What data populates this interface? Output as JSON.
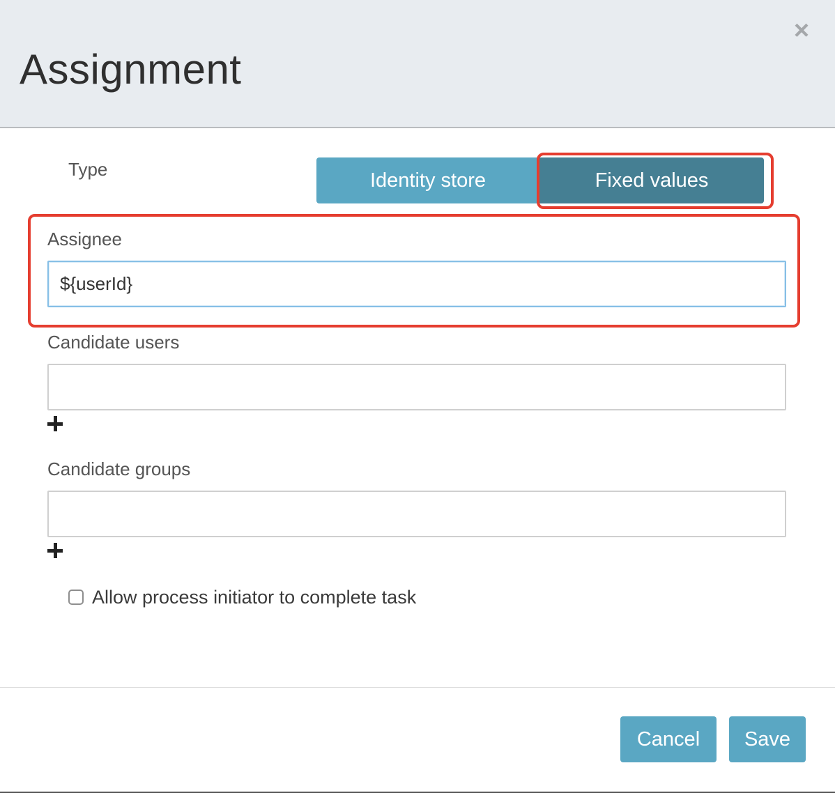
{
  "dialog": {
    "title": "Assignment",
    "close_glyph": "×",
    "close_icon": "close-icon"
  },
  "type_selector": {
    "label": "Type",
    "options": [
      "Identity store",
      "Fixed values"
    ],
    "selected": "Fixed values"
  },
  "fields": {
    "assignee": {
      "label": "Assignee",
      "value": "${userId}"
    },
    "candidate_users": {
      "label": "Candidate users",
      "value": ""
    },
    "candidate_groups": {
      "label": "Candidate groups",
      "value": ""
    }
  },
  "allow_initiator": {
    "label": "Allow process initiator to complete task",
    "checked": false
  },
  "footer": {
    "cancel_label": "Cancel",
    "save_label": "Save"
  },
  "colors": {
    "primary": "#5aa7c3",
    "primary_active": "#457f93",
    "highlight": "#e53d2f",
    "header_bg": "#e8ecf0"
  }
}
